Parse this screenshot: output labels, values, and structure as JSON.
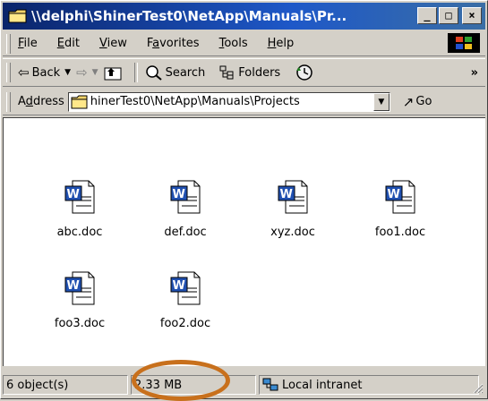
{
  "window": {
    "title": "\\\\delphi\\ShinerTest0\\NetApp\\Manuals\\Pr...",
    "caption_minimize": "_",
    "caption_maximize": "□",
    "caption_close": "×"
  },
  "menubar": {
    "items": [
      {
        "label": "File",
        "access": "F",
        "rest": "ile"
      },
      {
        "label": "Edit",
        "access": "E",
        "rest": "dit"
      },
      {
        "label": "View",
        "access": "V",
        "rest": "iew"
      },
      {
        "label": "Favorites",
        "pre": "F",
        "access": "a",
        "rest": "vorites"
      },
      {
        "label": "Tools",
        "access": "T",
        "rest": "ools"
      },
      {
        "label": "Help",
        "access": "H",
        "rest": "elp"
      }
    ]
  },
  "toolbar": {
    "back_label": "Back",
    "search_label": "Search",
    "folders_label": "Folders"
  },
  "address": {
    "label_pre": "A",
    "label_access": "d",
    "label_rest": "dress",
    "value": "hinerTest0\\NetApp\\Manuals\\Projects",
    "go_label": "Go"
  },
  "files": [
    {
      "name": "abc.doc"
    },
    {
      "name": "def.doc"
    },
    {
      "name": "xyz.doc"
    },
    {
      "name": "foo1.doc"
    },
    {
      "name": "foo3.doc"
    },
    {
      "name": "foo2.doc"
    }
  ],
  "statusbar": {
    "objects": "6 object(s)",
    "size": "2.33 MB",
    "zone": "Local intranet"
  },
  "colors": {
    "titlebar_start": "#0a246a",
    "titlebar_end": "#3a6ea5",
    "annotation_ring": "#c8701c"
  }
}
